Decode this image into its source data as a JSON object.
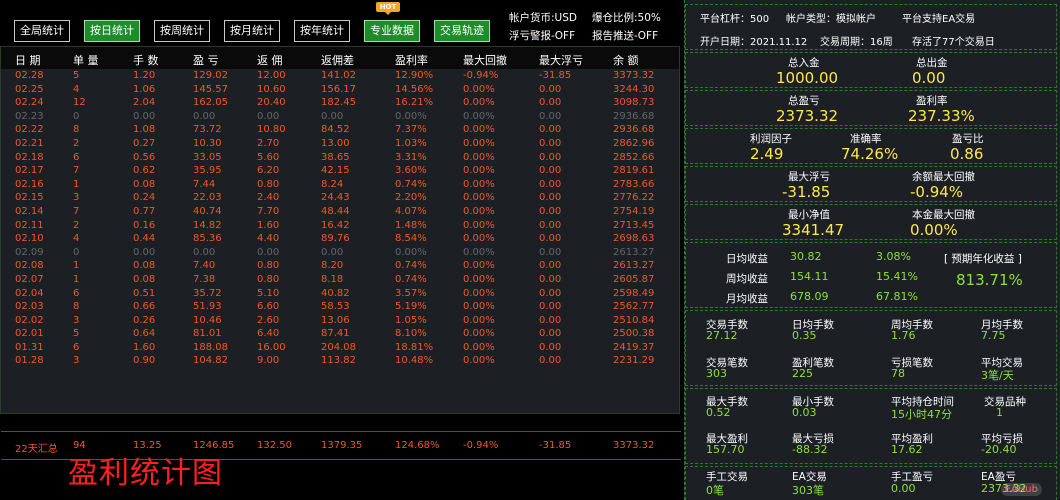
{
  "toolbar": {
    "buttons": [
      {
        "label": "全局统计",
        "active": false
      },
      {
        "label": "按日统计",
        "active": true
      },
      {
        "label": "按周统计",
        "active": false
      },
      {
        "label": "按月统计",
        "active": false
      },
      {
        "label": "按年统计",
        "active": false
      },
      {
        "label": "专业数据",
        "active": true
      },
      {
        "label": "交易轨迹",
        "active": true
      }
    ],
    "hot_badge": "HOT",
    "account_currency": "帐户货币:USD",
    "margin_ratio": "爆仓比例:50%",
    "floating_alert": "浮亏警报-OFF",
    "report_push": "报告推送-OFF"
  },
  "table": {
    "headers": [
      "日 期",
      "单 量",
      "手 数",
      "盈 亏",
      "返 佣",
      "返佣差",
      "盈利率",
      "最大回撤",
      "最大浮亏",
      "余 额"
    ],
    "rows": [
      [
        "02.28",
        "5",
        "1.20",
        "129.02",
        "12.00",
        "141.02",
        "12.90%",
        "-0.94%",
        "-31.85",
        "3373.32"
      ],
      [
        "02.25",
        "4",
        "1.06",
        "145.57",
        "10.60",
        "156.17",
        "14.56%",
        "0.00%",
        "0.00",
        "3244.30"
      ],
      [
        "02.24",
        "12",
        "2.04",
        "162.05",
        "20.40",
        "182.45",
        "16.21%",
        "0.00%",
        "0.00",
        "3098.73"
      ],
      [
        "02.23",
        "0",
        "0.00",
        "0.00",
        "0.00",
        "0.00",
        "0.00%",
        "0.00%",
        "0.00",
        "2936.68"
      ],
      [
        "02.22",
        "8",
        "1.08",
        "73.72",
        "10.80",
        "84.52",
        "7.37%",
        "0.00%",
        "0.00",
        "2936.68"
      ],
      [
        "02.21",
        "2",
        "0.27",
        "10.30",
        "2.70",
        "13.00",
        "1.03%",
        "0.00%",
        "0.00",
        "2862.96"
      ],
      [
        "02.18",
        "6",
        "0.56",
        "33.05",
        "5.60",
        "38.65",
        "3.31%",
        "0.00%",
        "0.00",
        "2852.66"
      ],
      [
        "02.17",
        "7",
        "0.62",
        "35.95",
        "6.20",
        "42.15",
        "3.60%",
        "0.00%",
        "0.00",
        "2819.61"
      ],
      [
        "02.16",
        "1",
        "0.08",
        "7.44",
        "0.80",
        "8.24",
        "0.74%",
        "0.00%",
        "0.00",
        "2783.66"
      ],
      [
        "02.15",
        "3",
        "0.24",
        "22.03",
        "2.40",
        "24.43",
        "2.20%",
        "0.00%",
        "0.00",
        "2776.22"
      ],
      [
        "02.14",
        "7",
        "0.77",
        "40.74",
        "7.70",
        "48.44",
        "4.07%",
        "0.00%",
        "0.00",
        "2754.19"
      ],
      [
        "02.11",
        "2",
        "0.16",
        "14.82",
        "1.60",
        "16.42",
        "1.48%",
        "0.00%",
        "0.00",
        "2713.45"
      ],
      [
        "02.10",
        "4",
        "0.44",
        "85.36",
        "4.40",
        "89.76",
        "8.54%",
        "0.00%",
        "0.00",
        "2698.63"
      ],
      [
        "02.09",
        "0",
        "0.00",
        "0.00",
        "0.00",
        "0.00",
        "0.00%",
        "0.00%",
        "0.00",
        "2613.27"
      ],
      [
        "02.08",
        "1",
        "0.08",
        "7.40",
        "0.80",
        "8.20",
        "0.74%",
        "0.00%",
        "0.00",
        "2613.27"
      ],
      [
        "02.07",
        "1",
        "0.08",
        "7.38",
        "0.80",
        "8.18",
        "0.74%",
        "0.00%",
        "0.00",
        "2605.87"
      ],
      [
        "02.04",
        "6",
        "0.51",
        "35.72",
        "5.10",
        "40.82",
        "3.57%",
        "0.00%",
        "0.00",
        "2598.49"
      ],
      [
        "02.03",
        "8",
        "0.66",
        "51.93",
        "6.60",
        "58.53",
        "5.19%",
        "0.00%",
        "0.00",
        "2562.77"
      ],
      [
        "02.02",
        "3",
        "0.26",
        "10.46",
        "2.60",
        "13.06",
        "1.05%",
        "0.00%",
        "0.00",
        "2510.84"
      ],
      [
        "02.01",
        "5",
        "0.64",
        "81.01",
        "6.40",
        "87.41",
        "8.10%",
        "0.00%",
        "0.00",
        "2500.38"
      ],
      [
        "01.31",
        "6",
        "1.60",
        "188.08",
        "16.00",
        "204.08",
        "18.81%",
        "0.00%",
        "0.00",
        "2419.37"
      ],
      [
        "01.28",
        "3",
        "0.90",
        "104.82",
        "9.00",
        "113.82",
        "10.48%",
        "0.00%",
        "0.00",
        "2231.29"
      ]
    ],
    "summary": [
      "22天汇总",
      "94",
      "13.25",
      "1246.85",
      "132.50",
      "1379.35",
      "124.68%",
      "-0.94%",
      "-31.85",
      "3373.32"
    ]
  },
  "caption": "盈利统计图",
  "info": {
    "leverage": "平台杠杆：500",
    "account_type": "帐户类型：模拟帐户",
    "ea_support": "平台支持EA交易",
    "open_date": "开户日期：2021.11.12",
    "trade_cycle": "交易周期：16周",
    "survived": "存活了77个交易日"
  },
  "stats": {
    "deposit_label": "总入金",
    "deposit": "1000.00",
    "withdraw_label": "总出金",
    "withdraw": "0.00",
    "profit_label": "总盈亏",
    "profit": "2373.32",
    "profit_rate_label": "盈利率",
    "profit_rate": "237.33%",
    "profit_factor_label": "利润因子",
    "profit_factor": "2.49",
    "accuracy_label": "准确率",
    "accuracy": "74.26%",
    "pl_ratio_label": "盈亏比",
    "pl_ratio": "0.86",
    "max_float_label": "最大浮亏",
    "max_float": "-31.85",
    "max_balance_dd_label": "余额最大回撤",
    "max_balance_dd": "-0.94%",
    "min_equity_label": "最小净值",
    "min_equity": "3341.47",
    "max_principal_dd_label": "本金最大回撤",
    "max_principal_dd": "0.00%"
  },
  "returns": {
    "daily_label": "日均收益",
    "daily": "30.82",
    "daily_pct": "3.08%",
    "weekly_label": "周均收益",
    "weekly": "154.11",
    "weekly_pct": "15.41%",
    "monthly_label": "月均收益",
    "monthly": "678.09",
    "monthly_pct": "67.81%",
    "annual_label": "[ 预期年化收益 ]",
    "annual": "813.71%"
  },
  "trading": {
    "lots_label": "交易手数",
    "lots": "27.12",
    "daily_lots_label": "日均手数",
    "daily_lots": "0.35",
    "weekly_lots_label": "周均手数",
    "weekly_lots": "1.76",
    "monthly_lots_label": "月均手数",
    "monthly_lots": "7.75",
    "trades_label": "交易笔数",
    "trades": "303",
    "win_trades_label": "盈利笔数",
    "win_trades": "225",
    "loss_trades_label": "亏损笔数",
    "loss_trades": "78",
    "avg_trades_label": "平均交易",
    "avg_trades": "3笔/天",
    "max_lots_label": "最大手数",
    "max_lots": "0.52",
    "min_lots_label": "最小手数",
    "min_lots": "0.03",
    "avg_hold_label": "平均持仓时间",
    "avg_hold": "15小时47分",
    "symbols_label": "交易品种",
    "symbols": "1",
    "max_profit_label": "最大盈利",
    "max_profit": "157.70",
    "max_loss_label": "最大亏损",
    "max_loss": "-88.32",
    "avg_profit_label": "平均盈利",
    "avg_profit": "17.62",
    "avg_loss_label": "平均亏损",
    "avg_loss": "-20.40",
    "manual_label": "手工交易",
    "manual": "0笔",
    "ea_label": "EA交易",
    "ea": "303笔",
    "manual_pl_label": "手工盈亏",
    "manual_pl": "0.00",
    "ea_pl_label": "EA盈亏",
    "ea_pl": "2373.32"
  },
  "watermark": "EAHub",
  "colors": {
    "accent_green": "#1f8c2c",
    "loss_red": "#f0582a",
    "value_yellow": "#ffe94a",
    "value_green": "#8fe03a"
  }
}
